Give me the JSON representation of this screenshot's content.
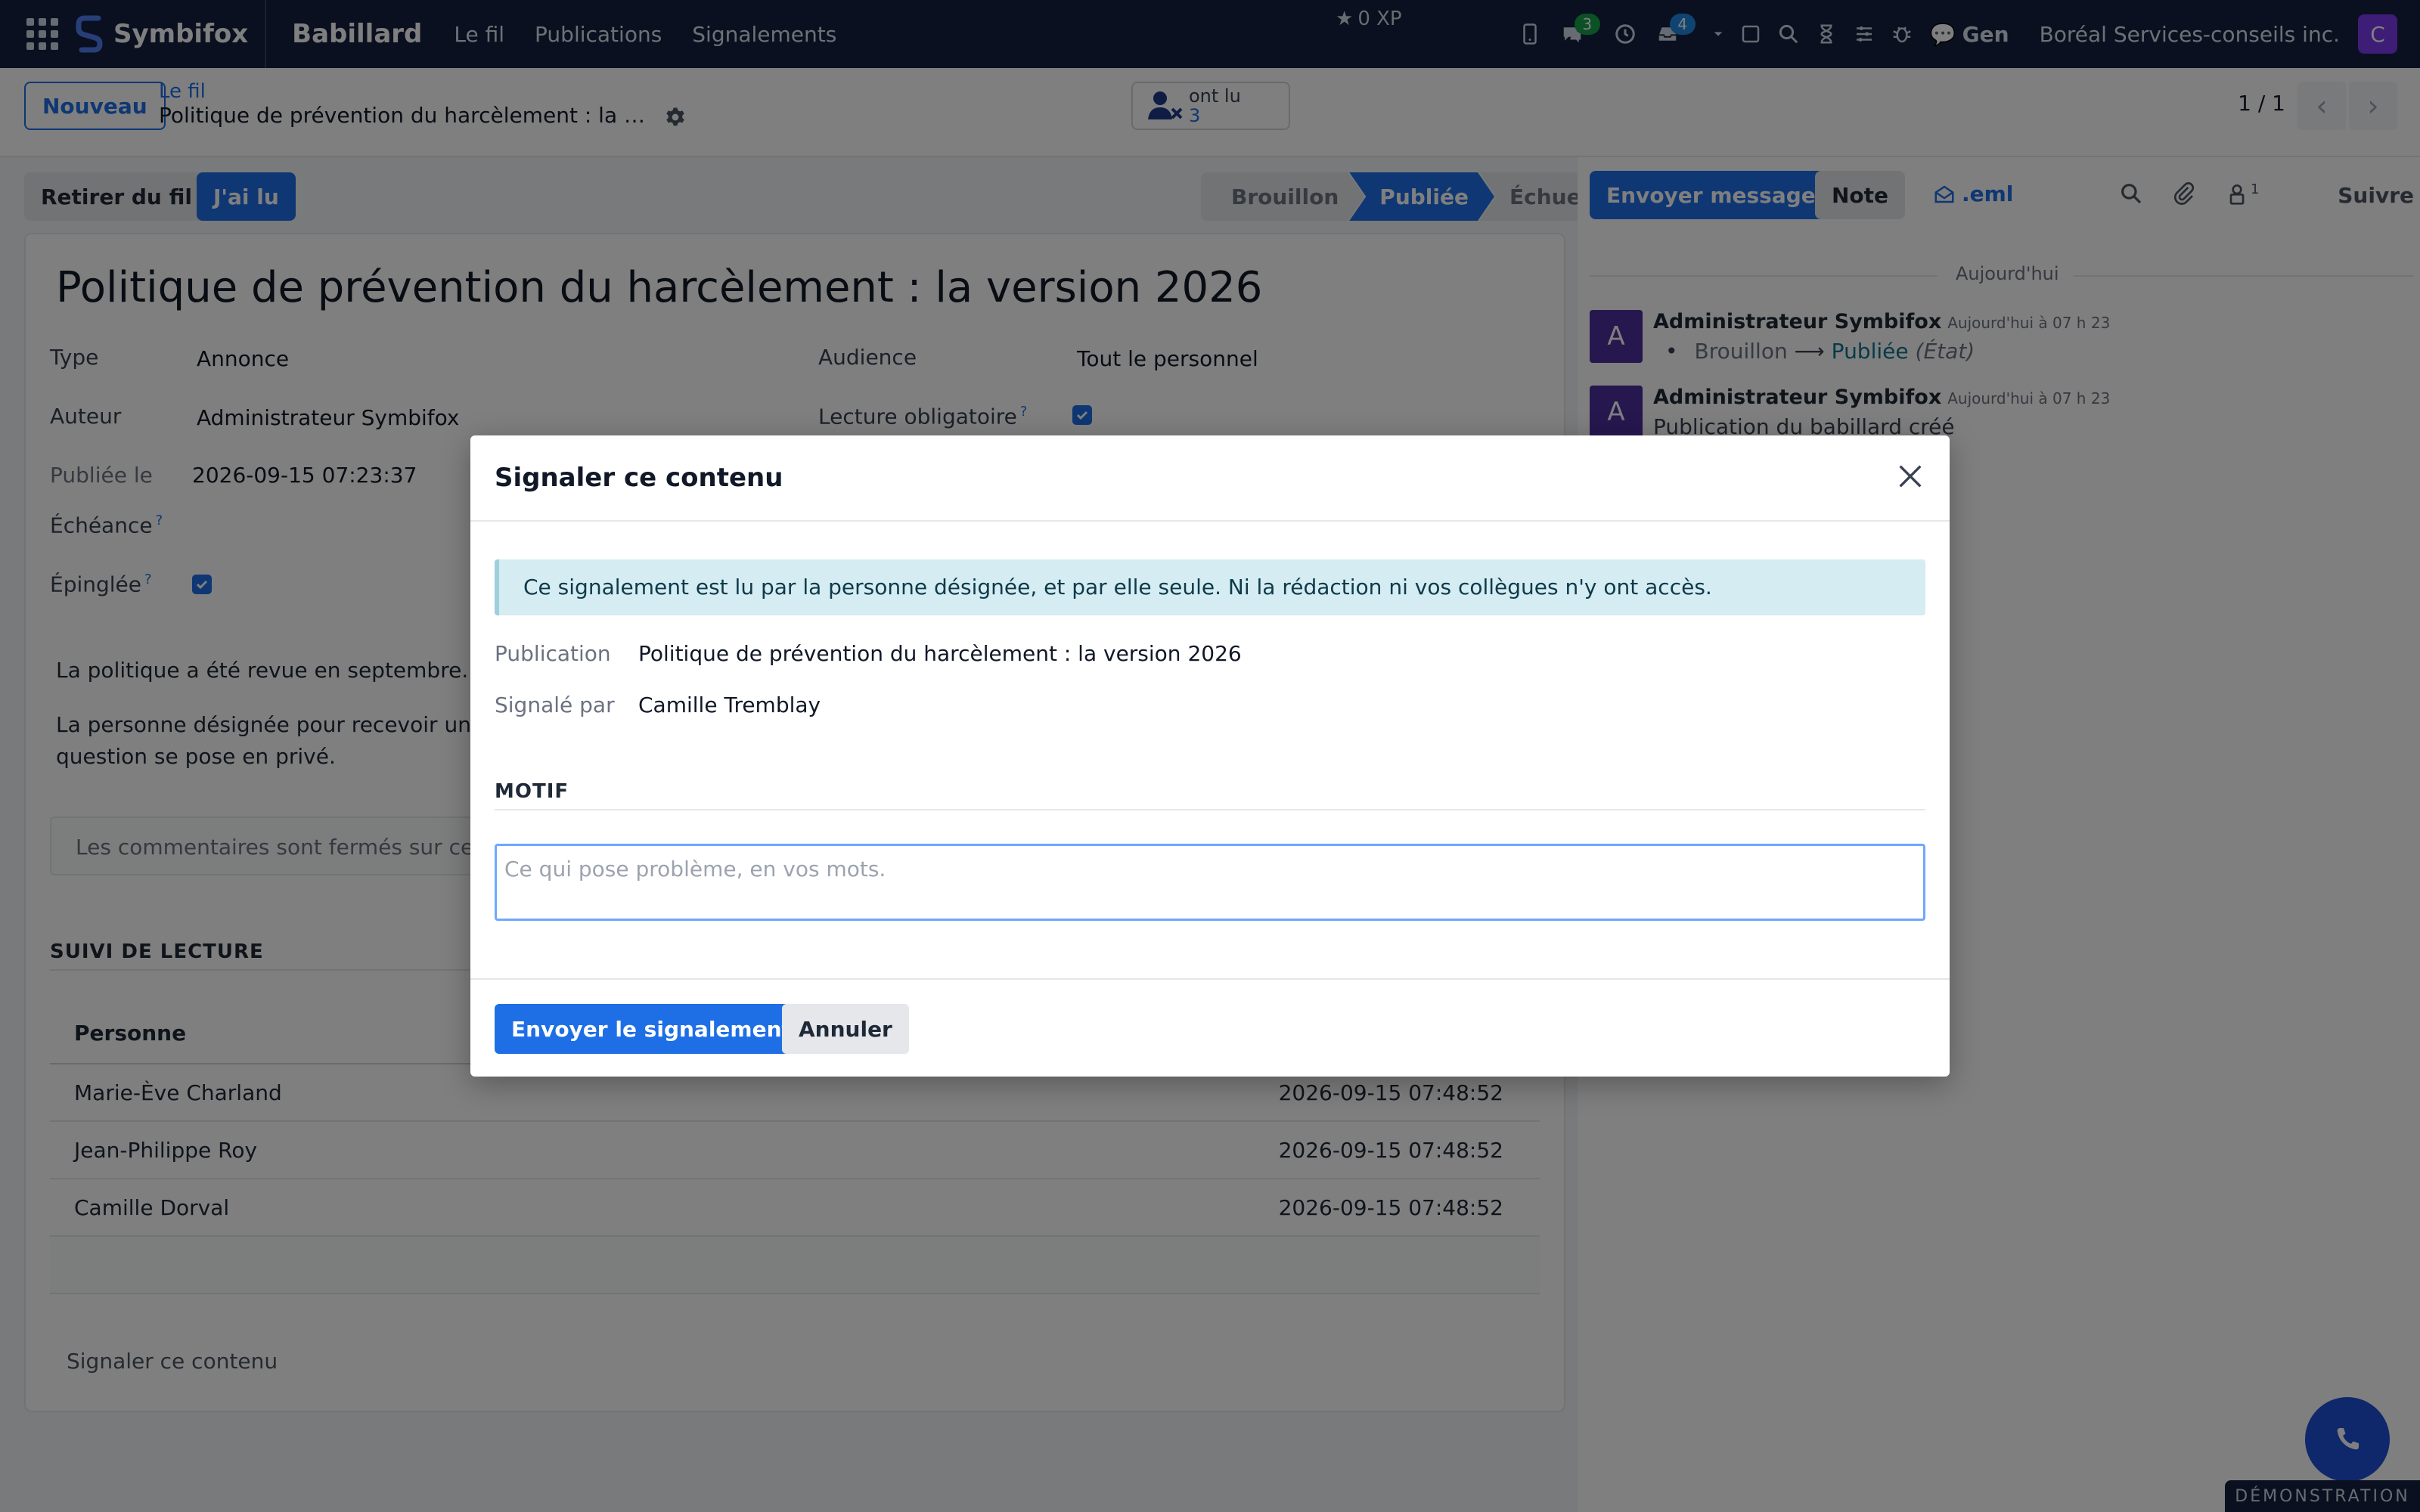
{
  "navbar": {
    "brand": "Symbifox",
    "app_title": "Babillard",
    "menu": [
      "Le fil",
      "Publications",
      "Signalements"
    ],
    "xp": "0 XP",
    "chat_badge": "3",
    "inbox_badge": "4",
    "gen_label": "Gen",
    "company": "Boréal Services-conseils inc.",
    "avatar_letter": "C",
    "icons": [
      "apps-grid-icon",
      "brand-logo-icon",
      "star-icon",
      "phone-icon",
      "chat-icon",
      "clock-icon",
      "inbox-icon",
      "caret-down-icon",
      "square-icon",
      "search-icon",
      "hourglass-icon",
      "sliders-icon",
      "bug-icon",
      "gen-chat-icon"
    ]
  },
  "control_panel": {
    "new_button": "Nouveau",
    "breadcrumb_parent": "Le fil",
    "breadcrumb_current": "Politique de prévention du harcèlement : la version 2026",
    "read_stat_label": "ont lu",
    "read_stat_count": "3",
    "pager": "1 / 1"
  },
  "status_bar": {
    "remove_button": "Retirer du fil",
    "read_button": "J'ai lu",
    "stages": [
      "Brouillon",
      "Publiée",
      "Échue"
    ],
    "active_stage": "Publiée"
  },
  "form": {
    "title": "Politique de prévention du harcèlement : la version 2026",
    "fields": {
      "type_label": "Type",
      "type_value": "Annonce",
      "author_label": "Auteur",
      "author_value": "Administrateur Symbifox",
      "published_label": "Publiée le",
      "published_value": "2026-09-15 07:23:37",
      "deadline_label": "Échéance",
      "pinned_label": "Épinglée",
      "audience_label": "Audience",
      "audience_value": "Tout le personnel",
      "mandatory_label": "Lecture obligatoire",
      "help_mark": "?"
    },
    "body_p1": "La politique a été revue en septembre. C",
    "body_p2_line1": "La personne désignée pour recevoir un s",
    "body_p2_line2": "question se pose en privé.",
    "comments_closed": "Les commentaires sont fermés sur cett",
    "tracking_title": "SUIVI DE LECTURE",
    "tracking_header": "Personne",
    "tracking_rows": [
      {
        "person": "Marie-Ève Charland",
        "date": "2026-09-15 07:48:52"
      },
      {
        "person": "Jean-Philippe Roy",
        "date": "2026-09-15 07:48:52"
      },
      {
        "person": "Camille Dorval",
        "date": "2026-09-15 07:48:52"
      }
    ],
    "report_link": "Signaler ce contenu"
  },
  "chatter": {
    "send_message": "Envoyer message",
    "note": "Note",
    "eml": ".eml",
    "followers_count": "1",
    "follow": "Suivre",
    "today": "Aujourd'hui",
    "messages": [
      {
        "avatar": "A",
        "author": "Administrateur Symbifox",
        "date": "Aujourd'hui à 07 h 23",
        "old_state": "Brouillon",
        "arrow": "⟶",
        "new_state": "Publiée",
        "field": "(État)"
      },
      {
        "avatar": "A",
        "author": "Administrateur Symbifox",
        "date": "Aujourd'hui à 07 h 23",
        "body": "Publication du babillard créé"
      }
    ]
  },
  "dialog": {
    "title": "Signaler ce contenu",
    "notice": "Ce signalement est lu par la personne désignée, et par elle seule. Ni la rédaction ni vos collègues n'y ont accès.",
    "publication_label": "Publication",
    "publication_value": "Politique de prévention du harcèlement : la version 2026",
    "reported_by_label": "Signalé par",
    "reported_by_value": "Camille Tremblay",
    "motif_title": "MOTIF",
    "motif_placeholder": "Ce qui pose problème, en vos mots.",
    "motif_value": "",
    "send_button": "Envoyer le signalement",
    "cancel_button": "Annuler"
  },
  "footer": {
    "demo_label": "DÉMONSTRATION"
  },
  "colors": {
    "navbar_bg": "#14213f",
    "primary": "#1e6fe6",
    "avatar_purple": "#4c2e9e",
    "alert_bg": "#d4ecf2"
  }
}
